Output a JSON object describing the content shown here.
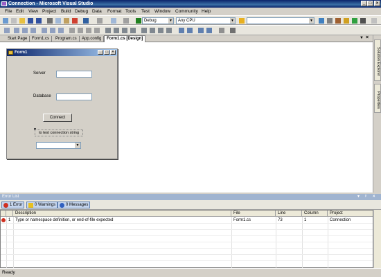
{
  "window": {
    "title": "Connection - Microsoft Visual Studio"
  },
  "menu": [
    "File",
    "Edit",
    "View",
    "Project",
    "Build",
    "Debug",
    "Data",
    "Format",
    "Tools",
    "Test",
    "Window",
    "Community",
    "Help"
  ],
  "toolbar": {
    "config": "Debug",
    "platform": "Any CPU",
    "find": ""
  },
  "tabs": [
    "Start Page",
    "Form1.cs",
    "Program.cs",
    "App.config",
    "Form1.cs [Design]"
  ],
  "side_tabs": [
    "Solution Explorer",
    "Properties"
  ],
  "form": {
    "title": "Form1",
    "server_label": "Server",
    "database_label": "Database",
    "connect_button": "Connect",
    "status_label": "to test connection string"
  },
  "error_list": {
    "title": "Error List",
    "errors_button": "1 Error",
    "warnings_button": "0 Warnings",
    "messages_button": "0 Messages",
    "columns": [
      "",
      "",
      "Description",
      "File",
      "Line",
      "Column",
      "Project"
    ],
    "rows": [
      {
        "num": "1",
        "description": "Type or namespace definition, or end-of-file expected",
        "file": "Form1.cs",
        "line": "73",
        "column": "1",
        "project": "Connection"
      }
    ]
  },
  "status": {
    "text": "Ready"
  },
  "colors": {
    "error": "#d03020",
    "warning": "#e8c020",
    "message": "#3060c0",
    "titlebar": "#0a246a"
  }
}
